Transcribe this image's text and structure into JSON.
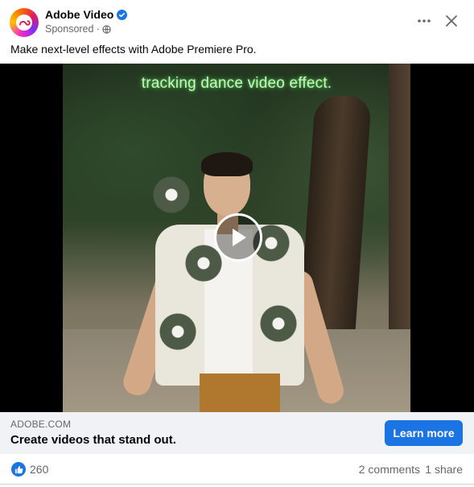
{
  "post": {
    "page_name": "Adobe Video",
    "sponsored_label": "Sponsored ·",
    "caption": "Make next-level effects with Adobe Premiere Pro.",
    "icons": {
      "avatar": "adobe-creative-cloud-logo",
      "verified": "verified-badge-icon",
      "privacy": "globe-icon",
      "more": "more-options-icon",
      "close": "close-icon",
      "play": "play-icon",
      "like": "like-icon"
    }
  },
  "video": {
    "overlay_text": "tracking dance video effect."
  },
  "link": {
    "domain": "ADOBE.COM",
    "title": "Create videos that stand out.",
    "cta_label": "Learn more"
  },
  "stats": {
    "likes": "260",
    "comments": "2 comments",
    "shares": "1 share"
  },
  "colors": {
    "accent": "#1b74e4",
    "secondary_text": "#65676b",
    "link_bar_bg": "#f0f2f5"
  }
}
